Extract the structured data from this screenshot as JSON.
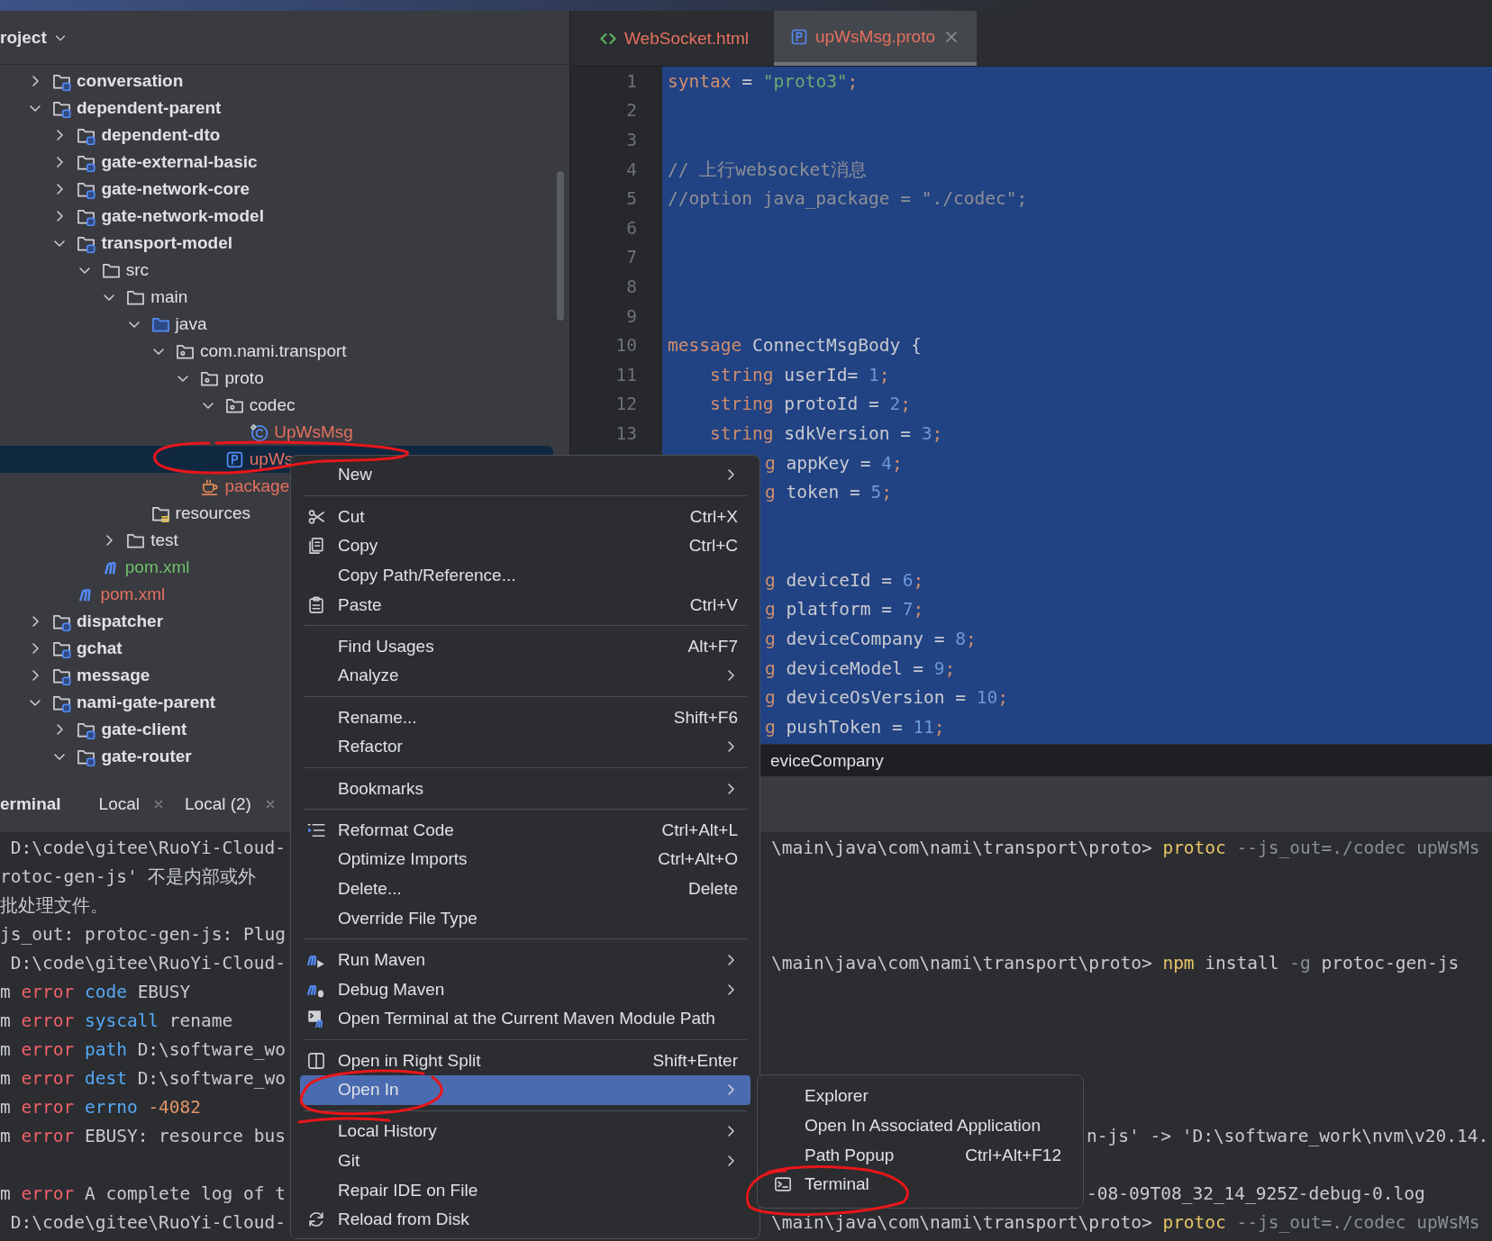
{
  "project_panel": {
    "title": "roject",
    "tree": [
      {
        "label": "conversation",
        "kind": "module",
        "expanded": false,
        "selected": false
      },
      {
        "label": "dependent-parent",
        "kind": "module",
        "expanded": true,
        "selected": false,
        "children": [
          {
            "label": "dependent-dto",
            "kind": "module",
            "expanded": false,
            "selected": false
          },
          {
            "label": "gate-external-basic",
            "kind": "module",
            "expanded": false,
            "selected": false
          },
          {
            "label": "gate-network-core",
            "kind": "module",
            "expanded": false,
            "selected": false
          },
          {
            "label": "gate-network-model",
            "kind": "module",
            "expanded": false,
            "selected": false
          },
          {
            "label": "transport-model",
            "kind": "module",
            "expanded": true,
            "selected": false,
            "children": [
              {
                "label": "src",
                "kind": "folder",
                "expanded": true,
                "selected": false,
                "children": [
                  {
                    "label": "main",
                    "kind": "folder",
                    "expanded": true,
                    "selected": false,
                    "children": [
                      {
                        "label": "java",
                        "kind": "source",
                        "expanded": true,
                        "selected": false,
                        "children": [
                          {
                            "label": "com.nami.transport",
                            "kind": "package",
                            "expanded": true,
                            "selected": false,
                            "children": [
                              {
                                "label": "proto",
                                "kind": "package",
                                "expanded": true,
                                "selected": false,
                                "children": [
                                  {
                                    "label": "codec",
                                    "kind": "package",
                                    "expanded": true,
                                    "selected": false,
                                    "children": [
                                      {
                                        "label": "UpWsMsg",
                                        "kind": "class",
                                        "color": "#e5705f",
                                        "selected": false
                                      }
                                    ]
                                  },
                                  {
                                    "label": "upWs",
                                    "kind": "proto",
                                    "color": "#e5705f",
                                    "selected": true
                                  }
                                ]
                              },
                              {
                                "label": "package",
                                "kind": "cup",
                                "color": "#e5705f",
                                "selected": false
                              }
                            ]
                          }
                        ]
                      },
                      {
                        "label": "resources",
                        "kind": "resources",
                        "selected": false
                      }
                    ]
                  },
                  {
                    "label": "test",
                    "kind": "folder",
                    "expanded": false,
                    "selected": false
                  }
                ]
              },
              {
                "label": "pom.xml",
                "kind": "maven",
                "color": "#6fbf6a",
                "selected": false
              }
            ]
          },
          {
            "label": "pom.xml",
            "kind": "maven",
            "color": "#e5705f",
            "selected": false
          }
        ]
      },
      {
        "label": "dispatcher",
        "kind": "module",
        "expanded": false,
        "selected": false
      },
      {
        "label": "gchat",
        "kind": "module",
        "expanded": false,
        "selected": false
      },
      {
        "label": "message",
        "kind": "module",
        "expanded": false,
        "selected": false
      },
      {
        "label": "nami-gate-parent",
        "kind": "module",
        "expanded": true,
        "selected": false,
        "children": [
          {
            "label": "gate-client",
            "kind": "module",
            "expanded": false,
            "selected": false
          },
          {
            "label": "gate-router",
            "kind": "module",
            "expanded": true,
            "selected": false
          }
        ]
      }
    ]
  },
  "editor": {
    "tabs": [
      {
        "label": "WebSocket.html",
        "kind": "html",
        "color": "#e5705f",
        "selected": false,
        "closable": false
      },
      {
        "label": "upWsMsg.proto",
        "kind": "proto",
        "color": "#e5705f",
        "selected": true,
        "closable": true
      }
    ],
    "lines": [
      {
        "kind": "full",
        "number": "1",
        "tokens": [
          {
            "kind": "kw",
            "text": "syntax"
          },
          {
            "kind": "plain",
            "text": " = "
          },
          {
            "kind": "str",
            "text": "\"proto3\""
          },
          {
            "kind": "kw",
            "text": ";"
          }
        ]
      },
      {
        "kind": "full",
        "number": "2"
      },
      {
        "kind": "full",
        "number": "3"
      },
      {
        "kind": "full",
        "number": "4",
        "tokens": [
          {
            "kind": "comment",
            "text": "// 上行websocket消息"
          }
        ]
      },
      {
        "kind": "full",
        "number": "5",
        "tokens": [
          {
            "kind": "comment",
            "text": "//option java_package = \"./codec\";"
          }
        ]
      },
      {
        "kind": "full",
        "number": "6"
      },
      {
        "kind": "full",
        "number": "7"
      },
      {
        "kind": "full",
        "number": "8"
      },
      {
        "kind": "full",
        "number": "9"
      },
      {
        "kind": "full",
        "number": "10",
        "tokens": [
          {
            "kind": "kw",
            "text": "message"
          },
          {
            "kind": "plain",
            "text": " ConnectMsgBody {"
          }
        ]
      },
      {
        "kind": "full",
        "number": "11",
        "tokens": [
          {
            "kind": "kw",
            "text": "    string"
          },
          {
            "kind": "plain",
            "text": " userId= "
          },
          {
            "kind": "num",
            "text": "1"
          },
          {
            "kind": "kw",
            "text": ";"
          }
        ]
      },
      {
        "kind": "full",
        "number": "12",
        "tokens": [
          {
            "kind": "kw",
            "text": "    string"
          },
          {
            "kind": "plain",
            "text": " protoId = "
          },
          {
            "kind": "num",
            "text": "2"
          },
          {
            "kind": "kw",
            "text": ";"
          }
        ]
      },
      {
        "kind": "full",
        "number": "13",
        "tokens": [
          {
            "kind": "kw",
            "text": "    string"
          },
          {
            "kind": "plain",
            "text": " sdkVersion = "
          },
          {
            "kind": "num",
            "text": "3"
          },
          {
            "kind": "kw",
            "text": ";"
          }
        ]
      },
      {
        "kind": "partial",
        "tokens": [
          {
            "kind": "kw",
            "text": "g"
          },
          {
            "kind": "plain",
            "text": " appKey = "
          },
          {
            "kind": "num",
            "text": "4"
          },
          {
            "kind": "kw",
            "text": ";"
          }
        ]
      },
      {
        "kind": "partial",
        "tokens": [
          {
            "kind": "kw",
            "text": "g"
          },
          {
            "kind": "plain",
            "text": " token = "
          },
          {
            "kind": "num",
            "text": "5"
          },
          {
            "kind": "kw",
            "text": ";"
          }
        ]
      },
      {
        "kind": "partial"
      },
      {
        "kind": "partial"
      },
      {
        "kind": "partial",
        "tokens": [
          {
            "kind": "kw",
            "text": "g"
          },
          {
            "kind": "plain",
            "text": " deviceId = "
          },
          {
            "kind": "num",
            "text": "6"
          },
          {
            "kind": "kw",
            "text": ";"
          }
        ]
      },
      {
        "kind": "partial",
        "tokens": [
          {
            "kind": "kw",
            "text": "g"
          },
          {
            "kind": "plain",
            "text": " platform = "
          },
          {
            "kind": "num",
            "text": "7"
          },
          {
            "kind": "kw",
            "text": ";"
          }
        ]
      },
      {
        "kind": "partial",
        "tokens": [
          {
            "kind": "kw",
            "text": "g"
          },
          {
            "kind": "plain",
            "text": " deviceCompany = "
          },
          {
            "kind": "num",
            "text": "8"
          },
          {
            "kind": "kw",
            "text": ";"
          }
        ]
      },
      {
        "kind": "partial",
        "tokens": [
          {
            "kind": "kw",
            "text": "g"
          },
          {
            "kind": "plain",
            "text": " deviceModel = "
          },
          {
            "kind": "num",
            "text": "9"
          },
          {
            "kind": "kw",
            "text": ";"
          }
        ]
      },
      {
        "kind": "partial",
        "tokens": [
          {
            "kind": "kw",
            "text": "g"
          },
          {
            "kind": "plain",
            "text": " deviceOsVersion = "
          },
          {
            "kind": "num",
            "text": "10"
          },
          {
            "kind": "kw",
            "text": ";"
          }
        ]
      },
      {
        "kind": "partial",
        "tokens": [
          {
            "kind": "kw",
            "text": "g"
          },
          {
            "kind": "plain",
            "text": " pushToken = "
          },
          {
            "kind": "num",
            "text": "11"
          },
          {
            "kind": "kw",
            "text": ";"
          }
        ]
      }
    ],
    "breadcrumb": "eviceCompany"
  },
  "terminal": {
    "title": "erminal",
    "tabs": [
      {
        "label": "Local",
        "selected": false
      },
      {
        "label": "Local (2)",
        "selected": false
      }
    ],
    "lines": [
      {
        "kind": "split",
        "left": [
          {
            "kind": "plain",
            "text": " D:\\code\\gitee\\RuoYi-Cloud-"
          }
        ],
        "right": [
          {
            "kind": "plain",
            "text": "\\main\\java\\com\\nami\\transport\\proto> "
          },
          {
            "kind": "cmd",
            "text": "protoc"
          },
          {
            "kind": "arg",
            "text": " --js_out=./codec upWsMs"
          }
        ]
      },
      {
        "kind": "left",
        "left": [
          {
            "kind": "plain",
            "text": "rotoc-gen-js' 不是内部或外"
          }
        ]
      },
      {
        "kind": "left",
        "left": [
          {
            "kind": "plain",
            "text": "批处理文件。"
          }
        ]
      },
      {
        "kind": "left",
        "left": [
          {
            "kind": "plain",
            "text": "js_out: protoc-gen-js: Plug"
          }
        ]
      },
      {
        "kind": "split",
        "left": [
          {
            "kind": "plain",
            "text": " D:\\code\\gitee\\RuoYi-Cloud-"
          }
        ],
        "right": [
          {
            "kind": "plain",
            "text": "\\main\\java\\com\\nami\\transport\\proto> "
          },
          {
            "kind": "cmd",
            "text": "npm"
          },
          {
            "kind": "plain",
            "text": " install "
          },
          {
            "kind": "arg",
            "text": "-g"
          },
          {
            "kind": "plain",
            "text": " protoc-gen-js"
          }
        ]
      },
      {
        "kind": "left",
        "left": [
          {
            "kind": "plain",
            "text": "m "
          },
          {
            "kind": "err",
            "text": "error"
          },
          {
            "kind": "key",
            "text": " code"
          },
          {
            "kind": "plain",
            "text": " EBUSY"
          }
        ]
      },
      {
        "kind": "left",
        "left": [
          {
            "kind": "plain",
            "text": "m "
          },
          {
            "kind": "err",
            "text": "error"
          },
          {
            "kind": "key",
            "text": " syscall"
          },
          {
            "kind": "plain",
            "text": " rename"
          }
        ]
      },
      {
        "kind": "left",
        "left": [
          {
            "kind": "plain",
            "text": "m "
          },
          {
            "kind": "err",
            "text": "error"
          },
          {
            "kind": "key",
            "text": " path"
          },
          {
            "kind": "plain",
            "text": " D:\\software_wo"
          }
        ]
      },
      {
        "kind": "left",
        "left": [
          {
            "kind": "plain",
            "text": "m "
          },
          {
            "kind": "err",
            "text": "error"
          },
          {
            "kind": "key",
            "text": " dest"
          },
          {
            "kind": "plain",
            "text": " D:\\software_wo"
          }
        ]
      },
      {
        "kind": "left",
        "left": [
          {
            "kind": "plain",
            "text": "m "
          },
          {
            "kind": "err",
            "text": "error"
          },
          {
            "kind": "key",
            "text": " errno"
          },
          {
            "kind": "num",
            "text": " -4082"
          }
        ]
      },
      {
        "kind": "split_wide",
        "left": [
          {
            "kind": "plain",
            "text": "m "
          },
          {
            "kind": "err",
            "text": "error"
          },
          {
            "kind": "plain",
            "text": " EBUSY: resource bus"
          }
        ],
        "right": [
          {
            "kind": "plain",
            "text": "n-js' -> 'D:\\software_work\\nvm\\v20.14."
          }
        ]
      },
      {
        "kind": "blank"
      },
      {
        "kind": "split_wide",
        "left": [
          {
            "kind": "plain",
            "text": "m "
          },
          {
            "kind": "err",
            "text": "error"
          },
          {
            "kind": "plain",
            "text": " A complete log of t"
          }
        ],
        "right": [
          {
            "kind": "plain",
            "text": "-08-09T08_32_14_925Z-debug-0.log"
          }
        ]
      },
      {
        "kind": "split",
        "left": [
          {
            "kind": "plain",
            "text": " D:\\code\\gitee\\RuoYi-Cloud-"
          }
        ],
        "right": [
          {
            "kind": "plain",
            "text": "\\main\\java\\com\\nami\\transport\\proto> "
          },
          {
            "kind": "cmd",
            "text": "protoc"
          },
          {
            "kind": "arg",
            "text": " --js_out=./codec upWsMs"
          }
        ]
      }
    ]
  },
  "context_menu": {
    "items": [
      {
        "kind": "plain",
        "label": "New",
        "submenu": true,
        "selected": false
      },
      {
        "kind": "separator"
      },
      {
        "kind": "cut",
        "label": "Cut",
        "shortcut": "Ctrl+X",
        "submenu": false,
        "selected": false
      },
      {
        "kind": "copy",
        "label": "Copy",
        "shortcut": "Ctrl+C",
        "submenu": false,
        "selected": false
      },
      {
        "kind": "plain",
        "label": "Copy Path/Reference...",
        "submenu": false,
        "selected": false
      },
      {
        "kind": "paste",
        "label": "Paste",
        "shortcut": "Ctrl+V",
        "submenu": false,
        "selected": false
      },
      {
        "kind": "separator"
      },
      {
        "kind": "plain",
        "label": "Find Usages",
        "shortcut": "Alt+F7",
        "submenu": false,
        "selected": false
      },
      {
        "kind": "plain",
        "label": "Analyze",
        "submenu": true,
        "selected": false
      },
      {
        "kind": "separator"
      },
      {
        "kind": "plain",
        "label": "Rename...",
        "shortcut": "Shift+F6",
        "submenu": false,
        "selected": false
      },
      {
        "kind": "plain",
        "label": "Refactor",
        "submenu": true,
        "selected": false
      },
      {
        "kind": "separator"
      },
      {
        "kind": "plain",
        "label": "Bookmarks",
        "submenu": true,
        "selected": false
      },
      {
        "kind": "separator"
      },
      {
        "kind": "reformat",
        "label": "Reformat Code",
        "shortcut": "Ctrl+Alt+L",
        "submenu": false,
        "selected": false
      },
      {
        "kind": "plain",
        "label": "Optimize Imports",
        "shortcut": "Ctrl+Alt+O",
        "submenu": false,
        "selected": false
      },
      {
        "kind": "plain",
        "label": "Delete...",
        "shortcut": "Delete",
        "submenu": false,
        "selected": false
      },
      {
        "kind": "plain",
        "label": "Override File Type",
        "submenu": false,
        "selected": false
      },
      {
        "kind": "separator"
      },
      {
        "kind": "run-maven",
        "label": "Run Maven",
        "submenu": true,
        "selected": false
      },
      {
        "kind": "debug-maven",
        "label": "Debug Maven",
        "submenu": true,
        "selected": false
      },
      {
        "kind": "maven-terminal",
        "label": "Open Terminal at the Current Maven Module Path",
        "submenu": false,
        "selected": false
      },
      {
        "kind": "separator"
      },
      {
        "kind": "split",
        "label": "Open in Right Split",
        "shortcut": "Shift+Enter",
        "submenu": false,
        "selected": false
      },
      {
        "kind": "plain",
        "label": "Open In",
        "submenu": true,
        "selected": true
      },
      {
        "kind": "separator"
      },
      {
        "kind": "plain",
        "label": "Local History",
        "submenu": true,
        "selected": false
      },
      {
        "kind": "plain",
        "label": "Git",
        "submenu": true,
        "selected": false
      },
      {
        "kind": "plain",
        "label": "Repair IDE on File",
        "submenu": false,
        "selected": false
      },
      {
        "kind": "reload",
        "label": "Reload from Disk",
        "submenu": false,
        "selected": false
      }
    ]
  },
  "submenu": {
    "items": [
      {
        "kind": "plain",
        "label": "Explorer",
        "submenu": false,
        "selected": false
      },
      {
        "kind": "plain",
        "label": "Open In Associated Application",
        "submenu": false,
        "selected": false
      },
      {
        "kind": "plain",
        "label": "Path Popup",
        "shortcut": "Ctrl+Alt+F12",
        "submenu": false,
        "selected": false
      },
      {
        "kind": "terminal",
        "label": "Terminal",
        "submenu": false,
        "selected": false
      }
    ]
  }
}
